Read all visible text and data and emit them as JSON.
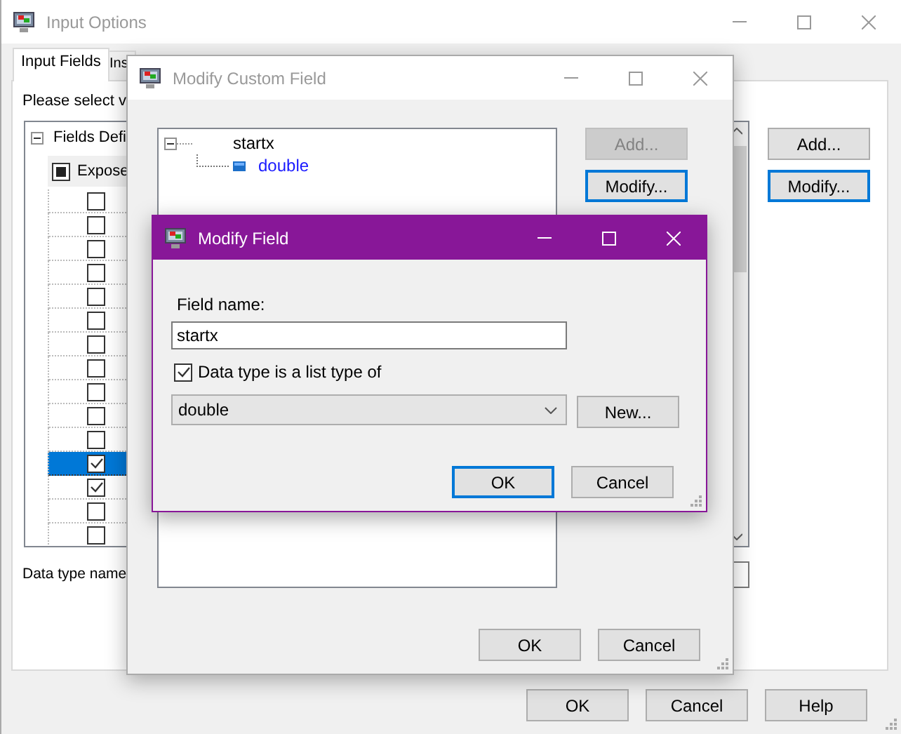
{
  "input_options": {
    "title": "Input Options",
    "active": false,
    "tabs": [
      {
        "label": "Input Fields",
        "selected": true
      },
      {
        "label": "Ins",
        "selected": false
      }
    ],
    "prompt": "Please select v",
    "fields_tree": {
      "label": "Fields Defi",
      "expanded": true,
      "column_header": "Expose",
      "header_indeterminate": true,
      "rows": [
        {
          "checked": false,
          "selected": false
        },
        {
          "checked": false,
          "selected": false
        },
        {
          "checked": false,
          "selected": false
        },
        {
          "checked": false,
          "selected": false
        },
        {
          "checked": false,
          "selected": false
        },
        {
          "checked": false,
          "selected": false
        },
        {
          "checked": false,
          "selected": false
        },
        {
          "checked": false,
          "selected": false
        },
        {
          "checked": false,
          "selected": false
        },
        {
          "checked": false,
          "selected": false
        },
        {
          "checked": false,
          "selected": false
        },
        {
          "checked": true,
          "selected": true
        },
        {
          "checked": true,
          "selected": false
        },
        {
          "checked": false,
          "selected": false
        },
        {
          "checked": false,
          "selected": false
        }
      ]
    },
    "data_type_label": "Data type name",
    "side_buttons": [
      {
        "label": "Add...",
        "focused": false
      },
      {
        "label": "Modify...",
        "focused": true
      }
    ],
    "buttons": [
      {
        "label": "OK",
        "focused": false
      },
      {
        "label": "Cancel",
        "focused": false
      },
      {
        "label": "Help",
        "focused": false
      }
    ]
  },
  "modify_custom_field": {
    "title": "Modify Custom Field",
    "active": false,
    "tree": [
      {
        "label": "startx",
        "expanded": true,
        "children": [
          {
            "label": "double"
          }
        ]
      }
    ],
    "side_buttons": [
      {
        "label": "Add...",
        "disabled": true,
        "focused": false
      },
      {
        "label": "Modify...",
        "disabled": false,
        "focused": true
      }
    ],
    "buttons": [
      {
        "label": "OK",
        "focused": false
      },
      {
        "label": "Cancel",
        "focused": false
      }
    ]
  },
  "modify_field": {
    "title": "Modify Field",
    "active": true,
    "field_label": "Field name:",
    "field_value": "startx",
    "list_type": {
      "label": "Data type is a list type of",
      "checked": true
    },
    "type_combo": {
      "value": "double"
    },
    "new_button": "New...",
    "buttons": [
      {
        "label": "OK",
        "focused": true
      },
      {
        "label": "Cancel",
        "focused": false
      }
    ]
  }
}
